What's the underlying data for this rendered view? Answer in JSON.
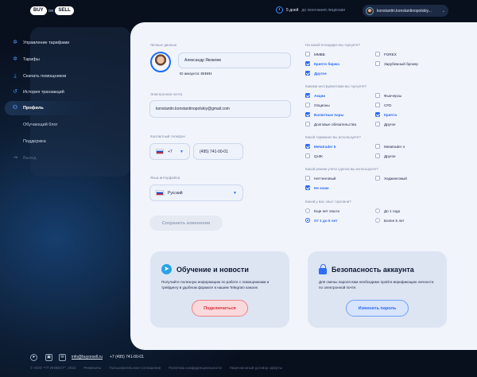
{
  "header": {
    "logo_buy": "BUY",
    "logo_or": "OR",
    "logo_sell": "SELL",
    "trial_days": "5 дней",
    "trial_text": "до окончания лицензии",
    "user_email": "konstantin.konstantinopolskiy..."
  },
  "sidebar": {
    "items": [
      {
        "label": "Управление тарифами",
        "icon": "gear-icon"
      },
      {
        "label": "Тарифы",
        "icon": "gear-icon"
      },
      {
        "label": "Скачать помощников",
        "icon": "download-icon"
      },
      {
        "label": "История транзакций",
        "icon": "history-icon"
      },
      {
        "label": "Профиль",
        "icon": "user-icon"
      },
      {
        "label": "Обучающий блог"
      },
      {
        "label": "Поддержка"
      },
      {
        "label": "Выход",
        "icon": "logout-icon"
      }
    ]
  },
  "profile": {
    "personal_label": "Личные данные",
    "name": "Александр Яковлев",
    "id_label": "ID аккаунта:",
    "id_value": "IIIIIIII",
    "email_label": "Электронная почта",
    "email": "konstantin.konstantinopolskiy@gmail.com",
    "phone_label": "Контактный телефон",
    "phone_code": "+7",
    "phone_number": "(495) 741-00-01",
    "lang_label": "Язык интерфейса",
    "lang": "Русский",
    "save_label": "Сохранить изменения"
  },
  "survey": {
    "q1": "На какой площадке вы торгуете?",
    "q1_options": [
      "ММВБ",
      "FOREX",
      "Крипто биржа",
      "Зарубежный брокер",
      "Другое"
    ],
    "q2": "Какими инструментами вы торгуете?",
    "q2_options": [
      "Акции",
      "Фьючерсы",
      "Опционы",
      "CFD",
      "Валютные пары",
      "Крипта",
      "Долговые обязательства",
      "Другое"
    ],
    "q3": "Какой терминал вы используете?",
    "q3_options": [
      "Metatrader 5",
      "Metatrader 4",
      "QUIK",
      "Другое"
    ],
    "q4": "Какой режим учета сделок вы используете?",
    "q4_options": [
      "Неттинговый",
      "Хеджинговый",
      "Не знаю"
    ],
    "q5": "Какой у вас опыт торговли?",
    "q5_options": [
      "Еще нет опыта",
      "До 1 года",
      "От 1 до 5 лет",
      "Более 5 лет"
    ]
  },
  "cards": {
    "news_title": "Обучение и новости",
    "news_desc": "Получайте полезную информацию по работе с помощниками и трейдингу в удобном формате в нашем Telegram канале.",
    "news_button": "Подключиться",
    "security_title": "Безопасность аккаунта",
    "security_desc": "Для смены пароля вам необходимо пройти верификацию личности по электронной почте.",
    "security_button": "Изменить пароль"
  },
  "footer": {
    "email": "info@buyorsell.ru",
    "phone": "+7 (495) 741-00-01",
    "links": [
      "© ООО \"ЧТ ИНВЕСТ\", 2022",
      "Реквизиты",
      "Пользовательское соглашение",
      "Политика конфиденциальности",
      "Лицензионный договор оферты"
    ]
  },
  "colors": {
    "accent": "#2f6df6",
    "danger": "#d6303b",
    "panel_bg": "#f1f4fb"
  }
}
